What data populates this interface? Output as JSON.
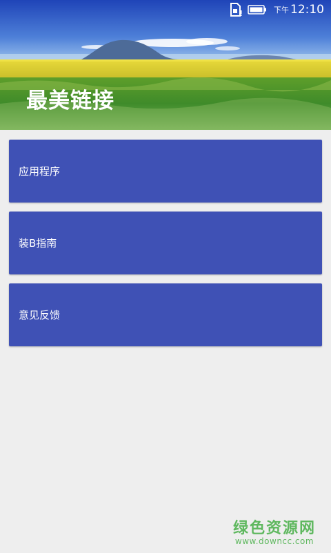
{
  "status_bar": {
    "period": "下午",
    "time": "12:10",
    "sim_icon": "sim-card-icon",
    "battery_icon": "battery-icon"
  },
  "header": {
    "title": "最美链接"
  },
  "menu": {
    "items": [
      {
        "label": "应用程序"
      },
      {
        "label": "装B指南"
      },
      {
        "label": "意见反馈"
      }
    ]
  },
  "watermark": {
    "main": "绿色资源网",
    "sub": "www.downcc.com"
  },
  "colors": {
    "card": "#3F51B5",
    "background": "#EEEEEE",
    "watermark": "#5FB85F"
  }
}
